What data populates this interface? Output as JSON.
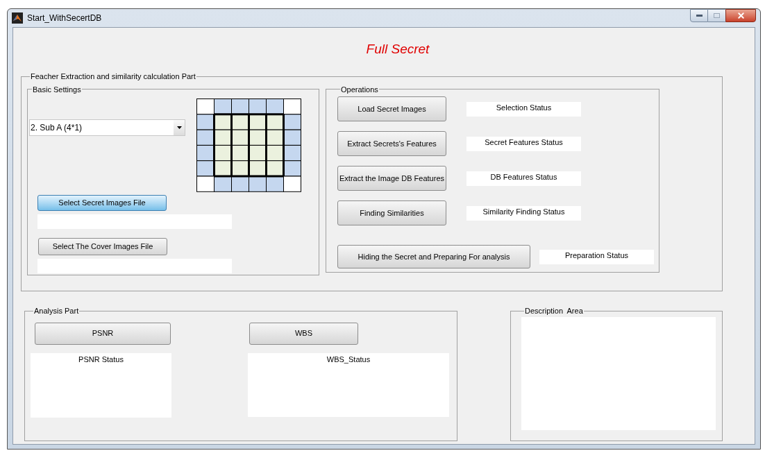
{
  "window": {
    "title": "Start_WithSecertDB"
  },
  "heading": "Full Secret",
  "extraction_panel": {
    "title": "Feacher Extraction and similarity calculation Part",
    "basic_settings": {
      "title": "Basic Settings",
      "dropdown": {
        "value": "2. Sub A (4*1)"
      },
      "file_selectors": [
        {
          "button": "Select Secret Images File",
          "focused": true
        },
        {
          "button": "Select The Cover Images File",
          "focused": false
        }
      ]
    },
    "operations": {
      "title": "Operations",
      "rows": [
        {
          "kind": "standard",
          "button": "Load Secret Images",
          "status": "Selection Status"
        },
        {
          "kind": "standard",
          "button": "Extract Secrets's Features",
          "status": "Secret Features Status"
        },
        {
          "kind": "standard",
          "button": "Extract the Image DB Features",
          "status": "DB Features Status"
        },
        {
          "kind": "standard",
          "button": "Finding Similarities",
          "status": "Similarity Finding Status"
        },
        {
          "kind": "wide",
          "button": "Hiding the Secret and Preparing For analysis",
          "status": "Preparation Status"
        }
      ]
    }
  },
  "analysis_panel": {
    "title": "Analysis Part",
    "metrics": [
      {
        "kind": "narrow",
        "button": "PSNR",
        "status": "PSNR Status"
      },
      {
        "kind": "wide",
        "button": "WBS",
        "status": "WBS_Status"
      }
    ]
  },
  "description_panel": {
    "title": "Description  Area"
  }
}
